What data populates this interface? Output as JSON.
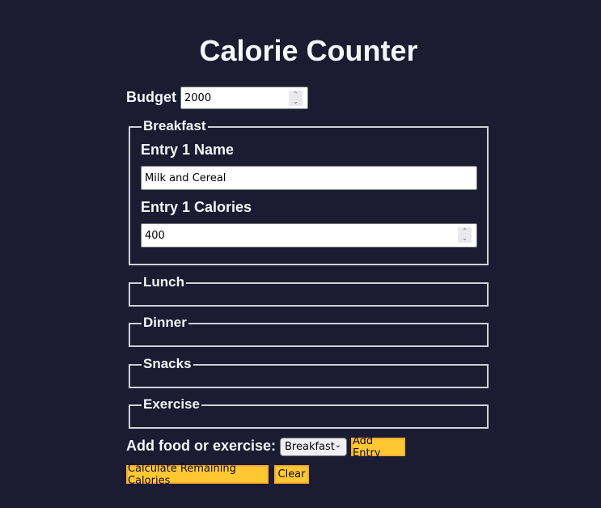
{
  "title": "Calorie Counter",
  "budget": {
    "label": "Budget",
    "value": "2000"
  },
  "fieldsets": {
    "breakfast": {
      "legend": "Breakfast",
      "entries": [
        {
          "name_label": "Entry 1 Name",
          "name_value": "Milk and Cereal",
          "calories_label": "Entry 1 Calories",
          "calories_value": "400"
        }
      ]
    },
    "lunch": {
      "legend": "Lunch"
    },
    "dinner": {
      "legend": "Dinner"
    },
    "snacks": {
      "legend": "Snacks"
    },
    "exercise": {
      "legend": "Exercise"
    }
  },
  "controls": {
    "add_label": "Add food or exercise:",
    "select_value": "Breakfast",
    "add_button": "Add Entry",
    "calculate_button": "Calculate Remaining Calories",
    "clear_button": "Clear"
  },
  "colors": {
    "background": "#1b1b32",
    "button": "#ffc832",
    "button_border": "#feac32"
  }
}
